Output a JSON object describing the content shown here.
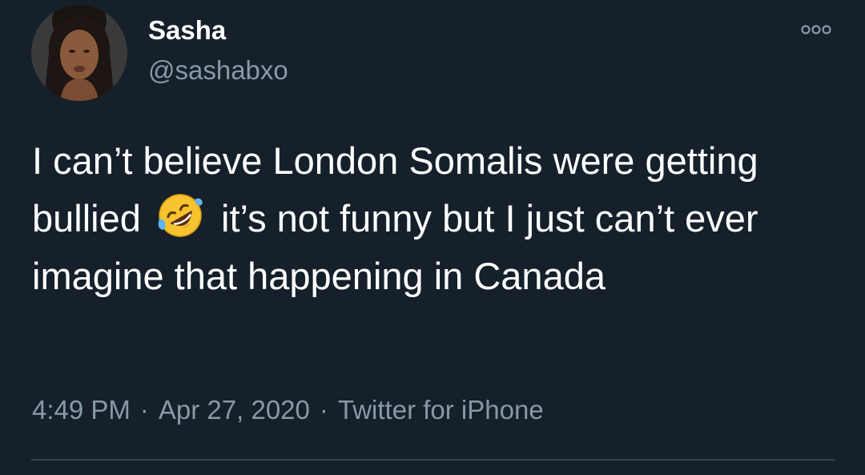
{
  "tweet": {
    "author": {
      "display_name": "Sasha",
      "handle": "@sashabxo"
    },
    "text": {
      "part1": "I can’t believe London Somalis were getting bullied",
      "emoji": "rolling-on-the-floor-laughing-emoji",
      "part2": "it’s not funny but I just can’t ever imagine that happening in Canada"
    },
    "meta": {
      "time": "4:49 PM",
      "separator": "·",
      "date": "Apr 27, 2020",
      "source": "Twitter for iPhone"
    },
    "more_icon": "more-options-icon"
  },
  "colors": {
    "background": "#15202b",
    "primary_text": "#ffffff",
    "secondary_text": "#8899a6",
    "divider": "#38444d"
  }
}
